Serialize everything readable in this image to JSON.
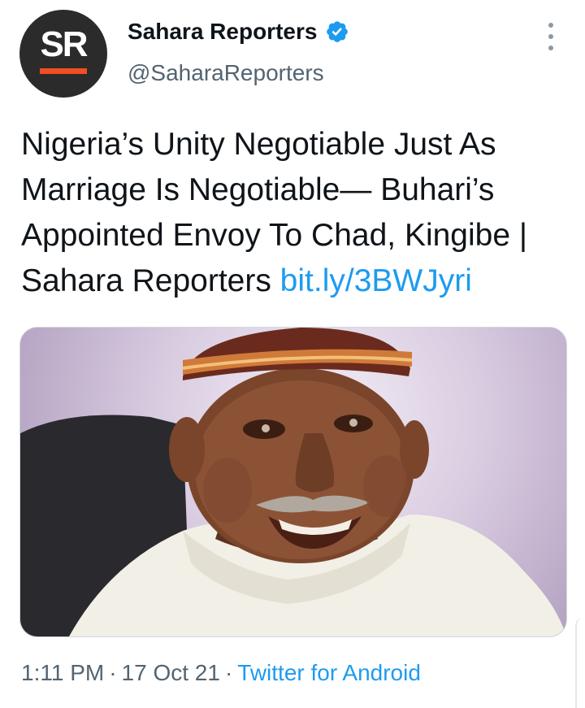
{
  "author": {
    "avatar_text": "SR",
    "display_name": "Sahara Reporters",
    "handle": "@SaharaReporters",
    "verified": true
  },
  "tweet": {
    "text": "Nigeria’s Unity Negotiable Just As Marriage Is Negotiable— Buhari’s Appointed Envoy To Chad, Kingibe | Sahara Reporters ",
    "link_text": "bit.ly/3BWJyri"
  },
  "meta": {
    "time": "1:11 PM",
    "separator": "·",
    "date": "17 Oct 21",
    "source": "Twitter for Android"
  },
  "colors": {
    "accent": "#1d9bf0",
    "brand_orange": "#f04e23",
    "avatar_bg": "#2b2b2b",
    "secondary_text": "#536471"
  },
  "icons": {
    "verified": "verified-badge-icon",
    "more": "more-vertical-icon"
  }
}
